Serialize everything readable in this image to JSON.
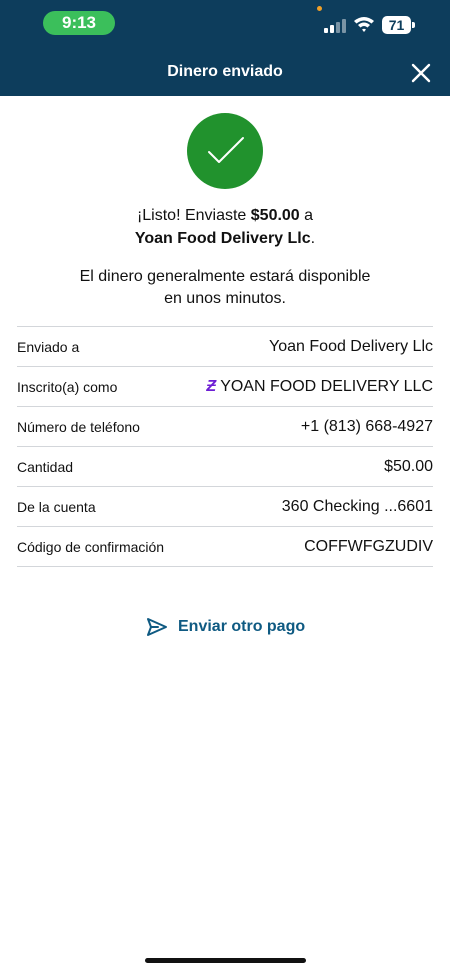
{
  "status_bar": {
    "time": "9:13",
    "battery": "71"
  },
  "header": {
    "title": "Dinero enviado",
    "close_icon": "close-icon"
  },
  "confirmation": {
    "line1_prefix": "¡Listo! Enviaste ",
    "amount": "$50.00",
    "line1_suffix": " a",
    "recipient": "Yoan Food Delivery Llc",
    "recipient_suffix": ".",
    "availability_line1": "El dinero generalmente estará disponible",
    "availability_line2": "en unos minutos."
  },
  "details": {
    "sent_to": {
      "label": "Enviado a",
      "value": "Yoan Food Delivery Llc"
    },
    "enrolled_as": {
      "label": "Inscrito(a) como",
      "value": "YOAN FOOD DELIVERY LLC",
      "icon": "zelle-icon"
    },
    "phone": {
      "label": "Número de teléfono",
      "value": "+1 (813) 668-4927"
    },
    "amount": {
      "label": "Cantidad",
      "value": "$50.00"
    },
    "from_account": {
      "label": "De la cuenta",
      "value": "360 Checking ...6601"
    },
    "confirmation_code": {
      "label": "Código de confirmación",
      "value": "COFFWFGZUDIV"
    }
  },
  "actions": {
    "send_again_label": "Enviar otro pago",
    "send_icon": "send-icon"
  },
  "colors": {
    "header": "#0d3d5c",
    "success": "#21922d",
    "link": "#0f5a82",
    "zelle": "#6d1ed4"
  }
}
